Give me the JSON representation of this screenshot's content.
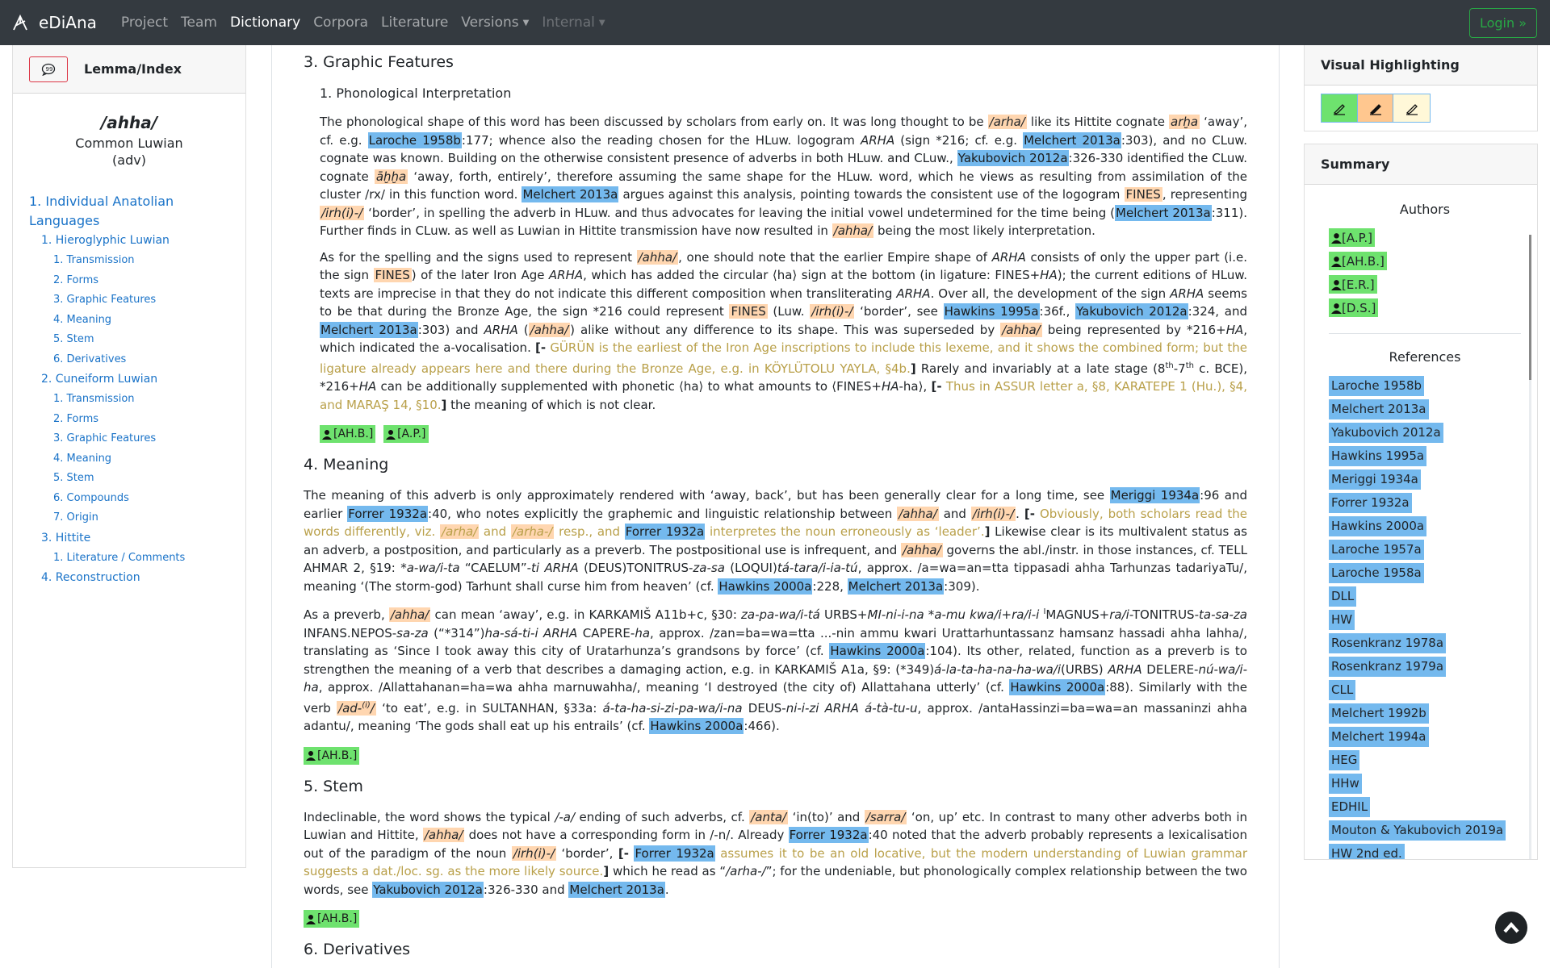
{
  "navbar": {
    "brand": "eDiAna",
    "links": [
      "Project",
      "Team",
      "Dictionary",
      "Corpora",
      "Literature",
      "Versions",
      "Internal"
    ],
    "login": "Login »"
  },
  "left": {
    "header": "Lemma/Index",
    "lemma": "/ahha/",
    "language": "Common Luwian",
    "pos": "(adv)",
    "toc": [
      {
        "level": 1,
        "label": "1. Individual Anatolian Languages"
      },
      {
        "level": 2,
        "label": "1. Hieroglyphic Luwian"
      },
      {
        "level": 3,
        "label": "1. Transmission"
      },
      {
        "level": 3,
        "label": "2. Forms"
      },
      {
        "level": 3,
        "label": "3. Graphic Features"
      },
      {
        "level": 3,
        "label": "4. Meaning"
      },
      {
        "level": 3,
        "label": "5. Stem"
      },
      {
        "level": 3,
        "label": "6. Derivatives"
      },
      {
        "level": 2,
        "label": "2. Cuneiform Luwian"
      },
      {
        "level": 3,
        "label": "1. Transmission"
      },
      {
        "level": 3,
        "label": "2. Forms"
      },
      {
        "level": 3,
        "label": "3. Graphic Features"
      },
      {
        "level": 3,
        "label": "4. Meaning"
      },
      {
        "level": 3,
        "label": "5. Stem"
      },
      {
        "level": 3,
        "label": "6. Compounds"
      },
      {
        "level": 3,
        "label": "7. Origin"
      },
      {
        "level": 2,
        "label": "3. Hittite"
      },
      {
        "level": 3,
        "label": "1. Literature / Comments"
      },
      {
        "level": 2,
        "label": "4. Reconstruction"
      }
    ]
  },
  "main": {
    "sec3": "3. Graphic Features",
    "sub1": "1. Phonological Interpretation",
    "sec4": "4. Meaning",
    "sec5": "5. Stem",
    "sec6": "6. Derivatives",
    "authors_graphic": [
      "[AH.B.]",
      "[A.P.]"
    ],
    "authors_meaning": [
      "[AH.B.]"
    ],
    "authors_stem": [
      "[AH.B.]"
    ]
  },
  "right": {
    "vh_title": "Visual Highlighting",
    "summary_title": "Summary",
    "authors_title": "Authors",
    "authors": [
      "[A.P.]",
      "[AH.B.]",
      "[E.R.]",
      "[D.S.]"
    ],
    "references_title": "References",
    "references": [
      "Laroche 1958b",
      "Melchert 2013a",
      "Yakubovich 2012a",
      "Hawkins 1995a",
      "Meriggi 1934a",
      "Forrer 1932a",
      "Hawkins 2000a",
      "Laroche 1957a",
      "Laroche 1958a",
      "DLL",
      "HW",
      "Rosenkranz 1978a",
      "Rosenkranz 1979a",
      "CLL",
      "Melchert 1992b",
      "Melchert 1994a",
      "HEG",
      "HHw",
      "EDHIL",
      "Mouton & Yakubovich 2019a",
      "HW 2nd ed."
    ]
  },
  "colors": {
    "navbar": "#343a40",
    "reference": "#74b9ee",
    "author": "#6ee26e",
    "word": "#ffd6b0",
    "comment": "#b9a04a",
    "link": "#1a73c8"
  }
}
